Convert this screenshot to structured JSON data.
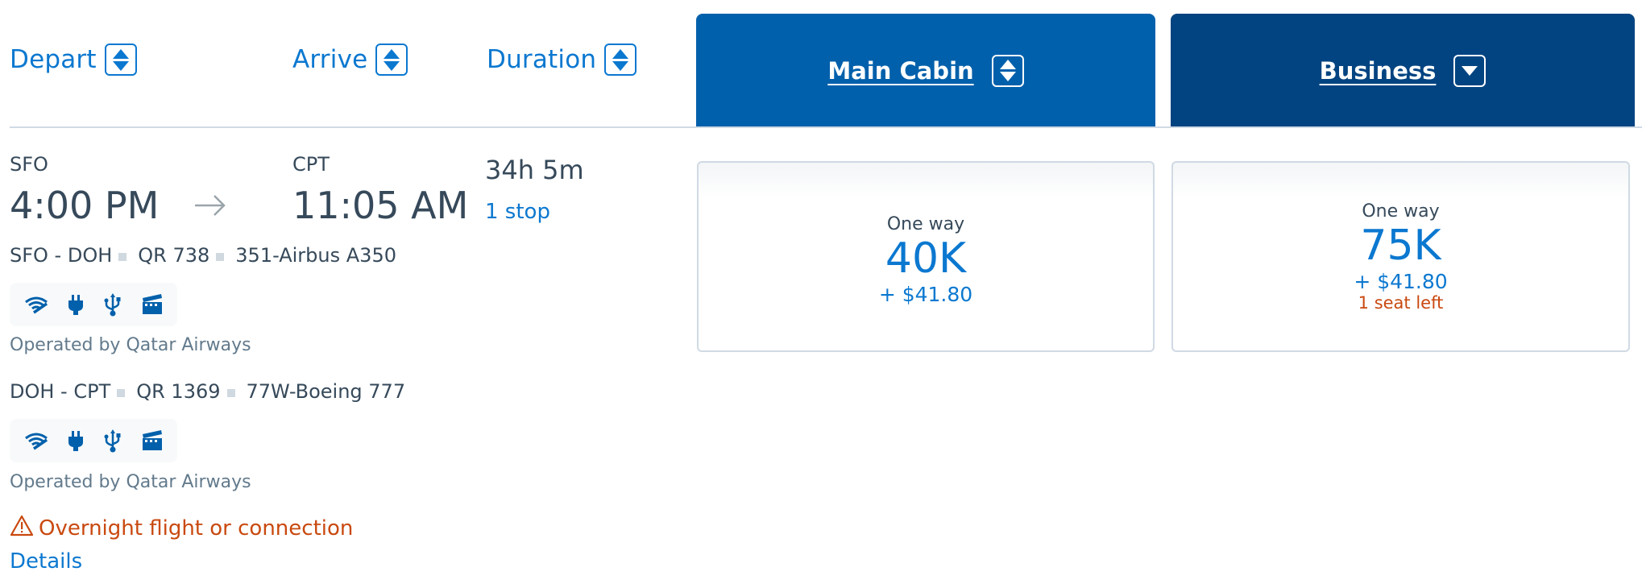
{
  "sort_headers": {
    "depart": "Depart",
    "arrive": "Arrive",
    "duration": "Duration"
  },
  "cabin_tabs": {
    "main": {
      "label": "Main Cabin",
      "sort_icon": "sort-up-down-icon",
      "color": "#0160ab"
    },
    "business": {
      "label": "Business",
      "sort_icon": "sort-down-icon",
      "color": "#024481"
    }
  },
  "flight": {
    "origin": "SFO",
    "depart_time": "4:00 PM",
    "destination": "CPT",
    "arrive_time": "11:05 AM",
    "duration": "34h 5m",
    "stops": "1 stop",
    "segments": [
      {
        "route": "SFO - DOH",
        "flight_number": "QR 738",
        "aircraft": "351-Airbus A350",
        "amenities": [
          "wifi-icon",
          "power-outlet-icon",
          "usb-icon",
          "entertainment-icon"
        ],
        "operated_by": "Operated by Qatar Airways"
      },
      {
        "route": "DOH - CPT",
        "flight_number": "QR 1369",
        "aircraft": "77W-Boeing 777",
        "amenities": [
          "wifi-icon",
          "power-outlet-icon",
          "usb-icon",
          "entertainment-icon"
        ],
        "operated_by": "Operated by Qatar Airways"
      }
    ],
    "warning": "Overnight flight or connection",
    "details_link": "Details"
  },
  "fares": {
    "main": {
      "trip_type": "One way",
      "miles": "40K",
      "taxes": "+ $41.80"
    },
    "business": {
      "trip_type": "One way",
      "miles": "75K",
      "taxes": "+ $41.80",
      "availability": "1 seat left"
    }
  },
  "colors": {
    "accent": "#0b78d0",
    "warning": "#c9490f",
    "text": "#36495a",
    "muted": "#627a8c"
  }
}
